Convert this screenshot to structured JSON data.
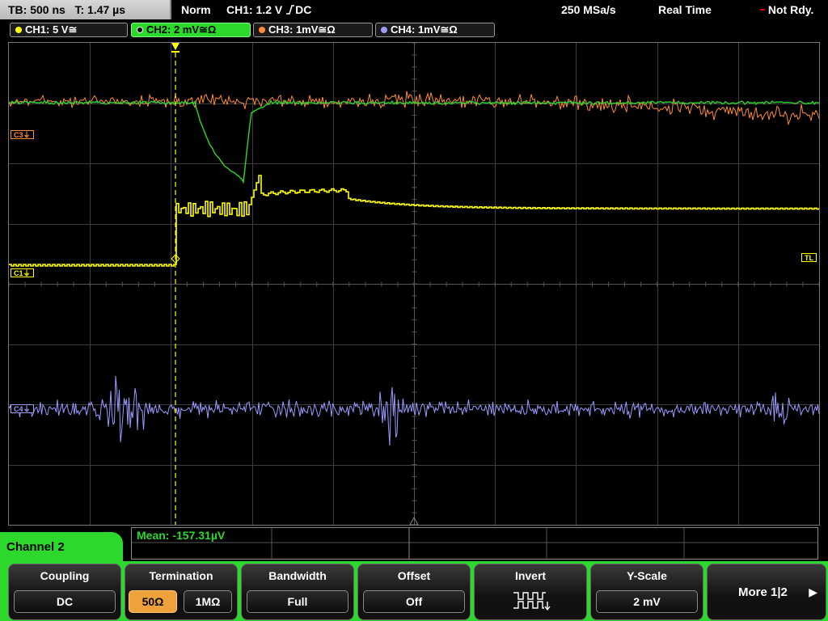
{
  "topbar": {
    "timebase": "TB: 500 ns",
    "trigger_time": "T: 1.47 µs",
    "mode": "Norm",
    "trigger_info": "CH1: 1.2 V",
    "trigger_coupling": "DC",
    "sample_rate": "250 MSa/s",
    "acq_mode": "Real Time",
    "status": "Not Rdy."
  },
  "channels": [
    {
      "label": "CH1: 5 V≅",
      "color": "#ffff00",
      "active": false
    },
    {
      "label": "CH2: 2 mV≅Ω",
      "color": "#2bd82b",
      "active": true
    },
    {
      "label": "CH3: 1mV≅Ω",
      "color": "#ff8c3a",
      "active": false
    },
    {
      "label": "CH4: 1mV≅Ω",
      "color": "#9a9aff",
      "active": false
    }
  ],
  "markers": {
    "c3": "C3",
    "c1": "C1",
    "c4": "C4",
    "trigger_level": "TL"
  },
  "measurement": {
    "mean": "Mean: -157.31µV"
  },
  "channel_menu": {
    "title": "Channel 2"
  },
  "softkeys": {
    "coupling": {
      "title": "Coupling",
      "value": "DC"
    },
    "termination": {
      "title": "Termination",
      "opt1": "50Ω",
      "opt2": "1MΩ",
      "selected": "50Ω"
    },
    "bandwidth": {
      "title": "Bandwidth",
      "value": "Full"
    },
    "offset": {
      "title": "Offset",
      "value": "Off"
    },
    "invert": {
      "title": "Invert",
      "icon": "invert-waveform-icon"
    },
    "yscale": {
      "title": "Y-Scale",
      "value": "2 mV"
    },
    "more": {
      "label": "More 1|2"
    }
  },
  "colors": {
    "ch1": "#ffff00",
    "ch2": "#2bd82b",
    "ch3": "#ff8c3a",
    "ch4": "#9a9aff",
    "grid": "#3c3c3c"
  }
}
